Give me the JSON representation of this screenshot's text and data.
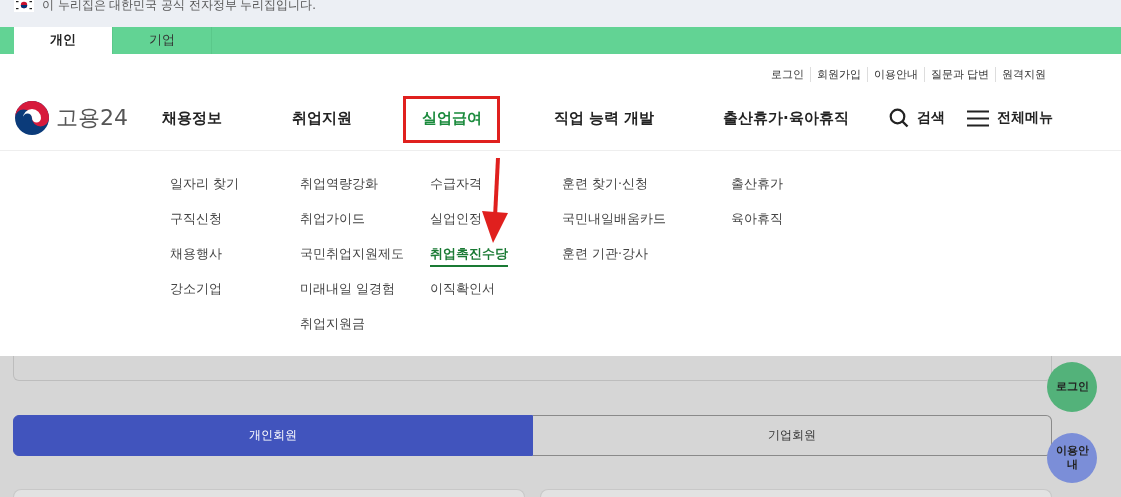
{
  "gov_banner": {
    "text": "이 누리집은 대한민국 공식 전자정부 누리집입니다."
  },
  "audience_tabs": [
    {
      "label": "개인",
      "selected": true
    },
    {
      "label": "기업",
      "selected": false
    }
  ],
  "utility_links": [
    "로그인",
    "회원가입",
    "이용안내",
    "질문과 답변",
    "원격지원"
  ],
  "logo": {
    "text": "고용24"
  },
  "nav": [
    {
      "label": "채용정보",
      "selected": false,
      "submenu": [
        {
          "label": "일자리 찾기",
          "selected": false
        },
        {
          "label": "구직신청",
          "selected": false
        },
        {
          "label": "채용행사",
          "selected": false
        },
        {
          "label": "강소기업",
          "selected": false
        }
      ]
    },
    {
      "label": "취업지원",
      "selected": false,
      "submenu": [
        {
          "label": "취업역량강화",
          "selected": false
        },
        {
          "label": "취업가이드",
          "selected": false
        },
        {
          "label": "국민취업지원제도",
          "selected": false
        },
        {
          "label": "미래내일 일경험",
          "selected": false
        },
        {
          "label": "취업지원금",
          "selected": false
        }
      ]
    },
    {
      "label": "실업급여",
      "selected": true,
      "submenu": [
        {
          "label": "수급자격",
          "selected": false
        },
        {
          "label": "실업인정",
          "selected": false
        },
        {
          "label": "취업촉진수당",
          "selected": true
        },
        {
          "label": "이직확인서",
          "selected": false
        }
      ]
    },
    {
      "label": "직업 능력 개발",
      "selected": false,
      "submenu": [
        {
          "label": "훈련 찾기·신청",
          "selected": false
        },
        {
          "label": "국민내일배움카드",
          "selected": false
        },
        {
          "label": "훈련 기관·강사",
          "selected": false
        }
      ]
    },
    {
      "label": "출산휴가·육아휴직",
      "selected": false,
      "submenu": [
        {
          "label": "출산휴가",
          "selected": false
        },
        {
          "label": "육아휴직",
          "selected": false
        }
      ]
    }
  ],
  "search_label": "검색",
  "all_menu_label": "전체메뉴",
  "member_tabs": [
    {
      "label": "개인회원",
      "selected": true
    },
    {
      "label": "기업회원",
      "selected": false
    }
  ],
  "floating_buttons": [
    {
      "label": "로그인",
      "color": "#53b27a"
    },
    {
      "label": "이용안내",
      "color": "#7b8ed8"
    }
  ]
}
